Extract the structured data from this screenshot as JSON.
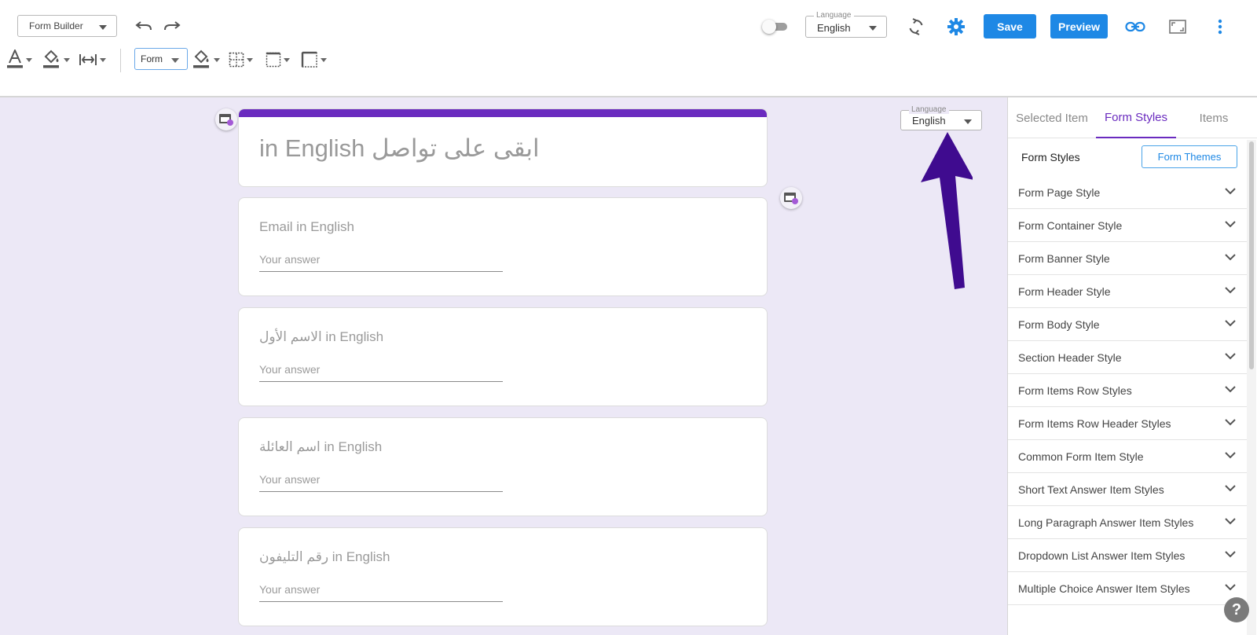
{
  "toolbar": {
    "mode": "Form Builder",
    "language_label": "Language",
    "language_value": "English",
    "save_label": "Save",
    "preview_label": "Preview",
    "scope": "Form",
    "icons": [
      "undo-icon",
      "redo-icon",
      "toggle-switch",
      "sync-icon",
      "gear-icon",
      "link-icon",
      "expand-icon",
      "more-vert-icon",
      "text-color-icon",
      "fill-color-icon",
      "spacing-icon",
      "cell-fill-icon",
      "grid-border-icon",
      "box-border-icon",
      "dashed-border-icon"
    ]
  },
  "form": {
    "title": "ابقى على تواصل in English",
    "questions": [
      {
        "label": "Email in English",
        "placeholder": "Your answer"
      },
      {
        "label": "الاسم الأول in English",
        "placeholder": "Your answer"
      },
      {
        "label": "اسم العائلة in English",
        "placeholder": "Your answer"
      },
      {
        "label": "رقم التليفون in English",
        "placeholder": "Your answer"
      }
    ],
    "language_label": "Language",
    "language_value": "English",
    "accent_color": "#6a2bbf",
    "background_color": "#ece8f6",
    "annotation_arrow_color": "#3f0b8f"
  },
  "panel": {
    "tabs": [
      "Selected Item",
      "Form Styles",
      "Items"
    ],
    "active_tab": "Form Styles",
    "heading": "Form Styles",
    "themes_button": "Form Themes",
    "sections": [
      "Form Page Style",
      "Form Container Style",
      "Form Banner Style",
      "Form Header Style",
      "Form Body Style",
      "Section Header Style",
      "Form Items Row Styles",
      "Form Items Row Header Styles",
      "Common Form Item Style",
      "Short Text Answer Item Styles",
      "Long Paragraph Answer Item Styles",
      "Dropdown List Answer Item Styles",
      "Multiple Choice Answer Item Styles"
    ]
  },
  "help": {
    "label": "?"
  }
}
